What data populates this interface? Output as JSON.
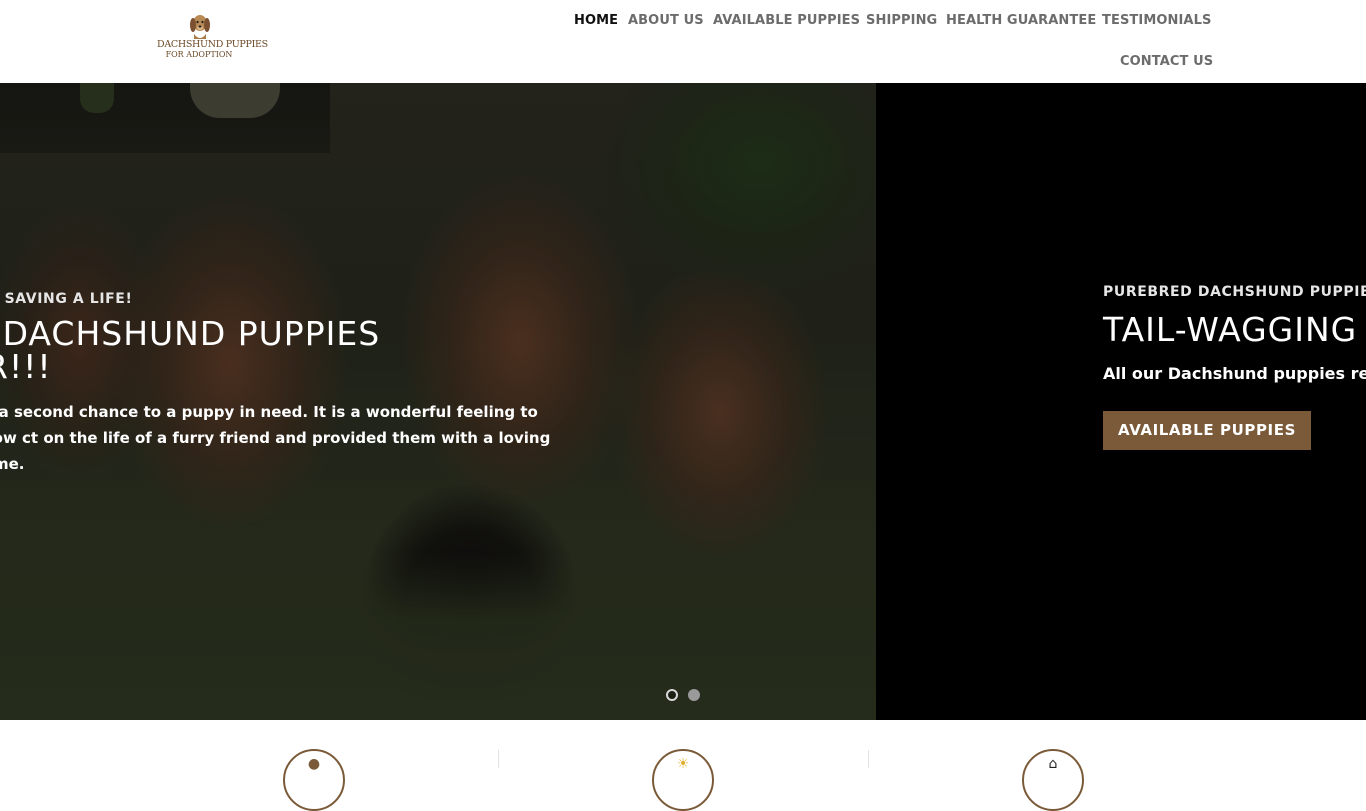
{
  "logo": {
    "line1": "DACHSHUND PUPPIES",
    "line2": "FOR ADOPTION",
    "icon": "dachshund-dog-icon"
  },
  "nav": {
    "items": [
      {
        "label": "HOME",
        "active": true
      },
      {
        "label": "ABOUT US",
        "active": false
      },
      {
        "label": "AVAILABLE PUPPIES",
        "active": false
      },
      {
        "label": "SHIPPING",
        "active": false
      },
      {
        "label": "HEALTH GUARANTEE",
        "active": false
      },
      {
        "label": "TESTIMONIALS",
        "active": false
      },
      {
        "label": "CONTACT US",
        "active": false
      }
    ]
  },
  "hero": {
    "slides": [
      {
        "kicker": "MEANS SAVING A LIFE!",
        "title": "UR DACHSHUND PUPPIES TER!!!",
        "text": "ng a second chance to a puppy in need. It is a wonderful feeling to know ct on the life of a furry friend and provided them with a loving home."
      },
      {
        "kicker": "PUREBRED DACHSHUND PUPPIES F",
        "title": "TAIL-WAGGING",
        "text": "All our Dachshund puppies receive",
        "button": "AVAILABLE PUPPIES"
      }
    ],
    "pagination": {
      "count": 2,
      "active": 0
    }
  },
  "features": {
    "icons": [
      "paw-icon",
      "sun-icon",
      "home-icon"
    ]
  },
  "colors": {
    "accent": "#7a5a38",
    "nav_active": "#111111",
    "nav_text": "#6c6c6c"
  }
}
